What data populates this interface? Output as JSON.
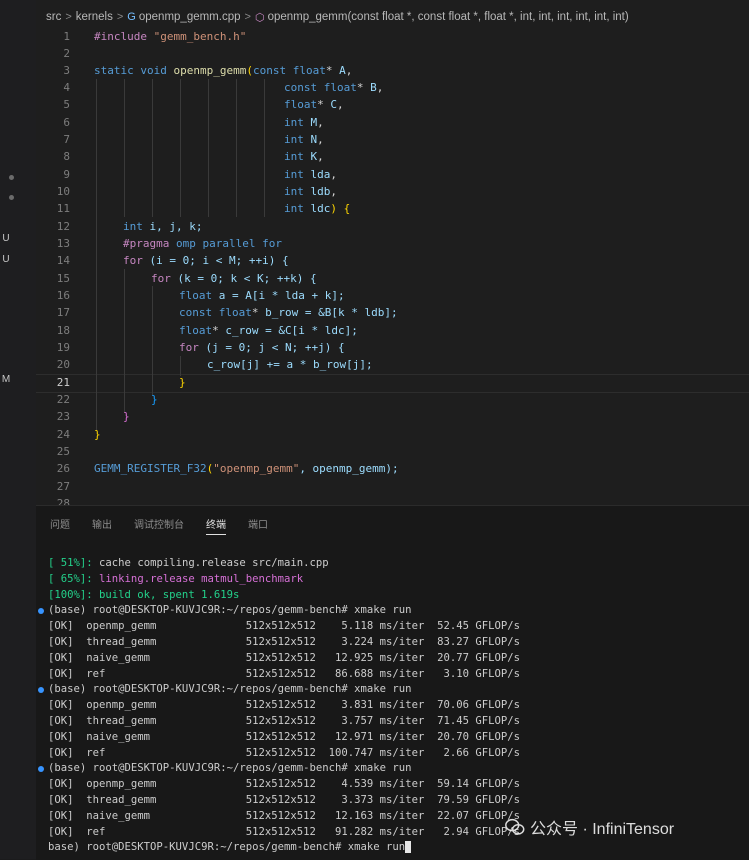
{
  "breadcrumb": {
    "seg1": "src",
    "seg2": "kernels",
    "seg3": "openmp_gemm.cpp",
    "seg4": "openmp_gemm(const float *, const float *, float *, int, int, int, int, int, int)"
  },
  "activity_markers": [
    "U",
    "U",
    "M"
  ],
  "line_numbers": [
    "1",
    "2",
    "3",
    "4",
    "5",
    "6",
    "7",
    "8",
    "9",
    "10",
    "11",
    "12",
    "13",
    "14",
    "15",
    "16",
    "17",
    "18",
    "19",
    "20",
    "21",
    "22",
    "23",
    "24",
    "25",
    "26",
    "27",
    "28"
  ],
  "active_line": "21",
  "code": {
    "l1_directive": "#include",
    "l1_header": "\"gemm_bench.h\"",
    "l3_static": "static",
    "l3_void": "void",
    "l3_fn": "openmp_gemm",
    "l3_paren": "(",
    "l3_const": "const",
    "l3_float": "float",
    "l3_star": "*",
    "l3_param": "A",
    "l4_const": "const",
    "l4_float": "float",
    "l4_param": "B",
    "l5_float": "float",
    "l5_param": "C",
    "int": "int",
    "l6_param": "M",
    "l7_param": "N",
    "l8_param": "K",
    "l9_param": "lda",
    "l10_param": "ldb",
    "l11_param": "ldc",
    "l12_vars": "i, j, k;",
    "l13_pragma": "#pragma",
    "l13_rest": "omp parallel for",
    "for": "for",
    "l14_body": "(i = 0; i < M; ++i) {",
    "l15_body": "(k = 0; k < K; ++k) {",
    "l16_body": "a = A[i * lda + k];",
    "l17_body": "b_row = &B[k * ldb];",
    "l18_body": "c_row = &C[i * ldc];",
    "l19_body": "(j = 0; j < N; ++j) {",
    "l20_body": "c_row[j] += a * b_row[j];",
    "close": "}",
    "l26_macro": "GEMM_REGISTER_F32",
    "l26_str": "\"openmp_gemm\"",
    "l26_rest": ", openmp_gemm);"
  },
  "panel_tabs": [
    "问题",
    "输出",
    "调试控制台",
    "终端",
    "端口"
  ],
  "active_tab": "终端",
  "terminal": {
    "build1_pct": "[ 51%]:",
    "build1_text": "cache compiling.release src/main.cpp",
    "build2_pct": "[ 65%]:",
    "build2_text": "linking.release matmul_benchmark",
    "build3": "[100%]: build ok, spent 1.619s",
    "prompt": "(base) root@DESKTOP-KUVJC9R:~/repos/gemm-bench# xmake run",
    "runs": [
      [
        {
          "status": "[OK]",
          "name": "openmp_gemm",
          "size": "512x512x512",
          "ms": "5.118 ms/iter",
          "gflops": "52.45 GFLOP/s"
        },
        {
          "status": "[OK]",
          "name": "thread_gemm",
          "size": "512x512x512",
          "ms": "3.224 ms/iter",
          "gflops": "83.27 GFLOP/s"
        },
        {
          "status": "[OK]",
          "name": "naive_gemm",
          "size": "512x512x512",
          "ms": "12.925 ms/iter",
          "gflops": "20.77 GFLOP/s"
        },
        {
          "status": "[OK]",
          "name": "ref",
          "size": "512x512x512",
          "ms": "86.688 ms/iter",
          "gflops": "3.10 GFLOP/s"
        }
      ],
      [
        {
          "status": "[OK]",
          "name": "openmp_gemm",
          "size": "512x512x512",
          "ms": "3.831 ms/iter",
          "gflops": "70.06 GFLOP/s"
        },
        {
          "status": "[OK]",
          "name": "thread_gemm",
          "size": "512x512x512",
          "ms": "3.757 ms/iter",
          "gflops": "71.45 GFLOP/s"
        },
        {
          "status": "[OK]",
          "name": "naive_gemm",
          "size": "512x512x512",
          "ms": "12.971 ms/iter",
          "gflops": "20.70 GFLOP/s"
        },
        {
          "status": "[OK]",
          "name": "ref",
          "size": "512x512x512",
          "ms": "100.747 ms/iter",
          "gflops": "2.66 GFLOP/s"
        }
      ],
      [
        {
          "status": "[OK]",
          "name": "openmp_gemm",
          "size": "512x512x512",
          "ms": "4.539 ms/iter",
          "gflops": "59.14 GFLOP/s"
        },
        {
          "status": "[OK]",
          "name": "thread_gemm",
          "size": "512x512x512",
          "ms": "3.373 ms/iter",
          "gflops": "79.59 GFLOP/s"
        },
        {
          "status": "[OK]",
          "name": "naive_gemm",
          "size": "512x512x512",
          "ms": "12.163 ms/iter",
          "gflops": "22.07 GFLOP/s"
        },
        {
          "status": "[OK]",
          "name": "ref",
          "size": "512x512x512",
          "ms": "91.282 ms/iter",
          "gflops": "2.94 GFLOP/s"
        }
      ]
    ],
    "last_prompt": "base) root@DESKTOP-KUVJC9R:~/repos/gemm-bench# xmake run"
  },
  "watermark": "公众号 · InfiniTensor",
  "colors": {
    "prompt_bullet": "#3794ff",
    "build_ok": "#23d18b",
    "link": "#d670d6"
  }
}
